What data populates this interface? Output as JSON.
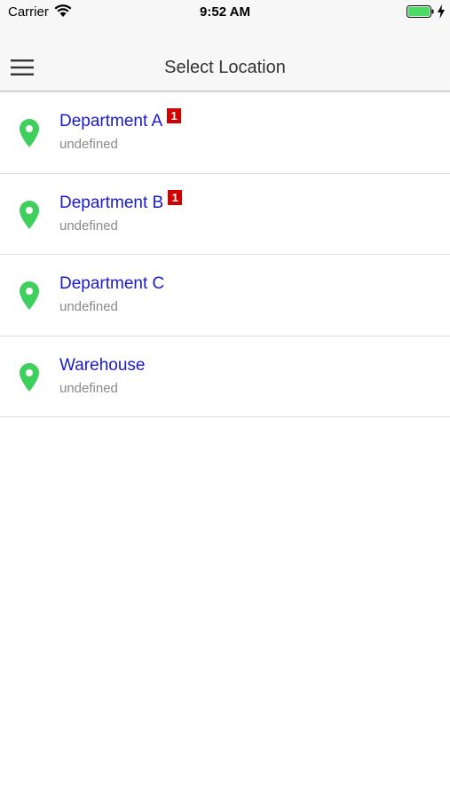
{
  "status_bar": {
    "carrier": "Carrier",
    "time": "9:52 AM"
  },
  "nav": {
    "title": "Select Location",
    "menu_icon": "hamburger-menu-icon"
  },
  "colors": {
    "accent_text": "#1a1acc",
    "pin": "#3ecf5c",
    "badge": "#d10000",
    "battery": "#4cd964"
  },
  "locations": [
    {
      "name": "Department A",
      "subtitle": "undefined",
      "badge": "1"
    },
    {
      "name": "Department B",
      "subtitle": "undefined",
      "badge": "1"
    },
    {
      "name": "Department C",
      "subtitle": "undefined",
      "badge": ""
    },
    {
      "name": "Warehouse",
      "subtitle": "undefined",
      "badge": ""
    }
  ]
}
